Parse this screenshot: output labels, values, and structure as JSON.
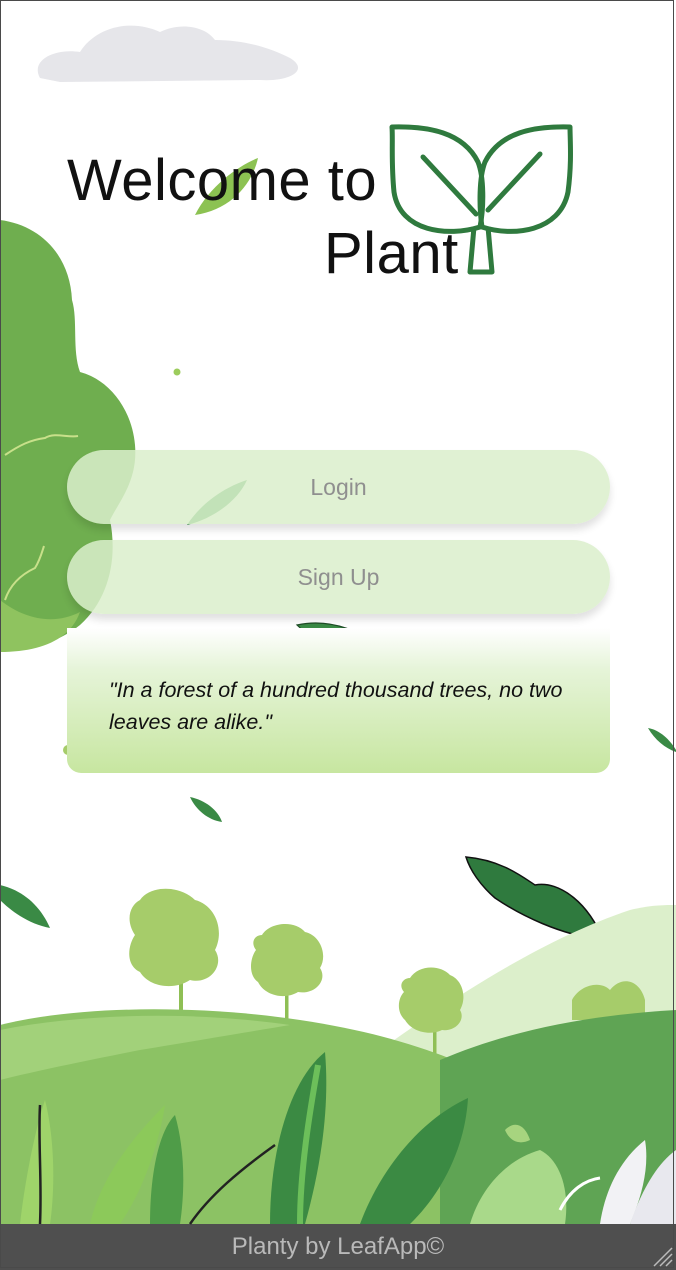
{
  "header": {
    "title_line1": "Welcome to",
    "title_line2": "Plant"
  },
  "actions": {
    "login_label": "Login",
    "signup_label": "Sign Up"
  },
  "quote": {
    "text": "\"In a forest of a hundred thousand trees, no two leaves are alike.\""
  },
  "footer": {
    "text": "Planty by LeafApp©"
  },
  "logo": {
    "icon": "sprout-icon",
    "color": "#2f7a3e"
  },
  "colors": {
    "button_fill": "#daefcb",
    "button_text": "#8f8f8f",
    "quote_gradient_end": "#c7e6a0",
    "leaf_dark": "#2f7a3e",
    "leaf_light": "#a6cc6a",
    "footer_bg": "#2a2a2a"
  }
}
